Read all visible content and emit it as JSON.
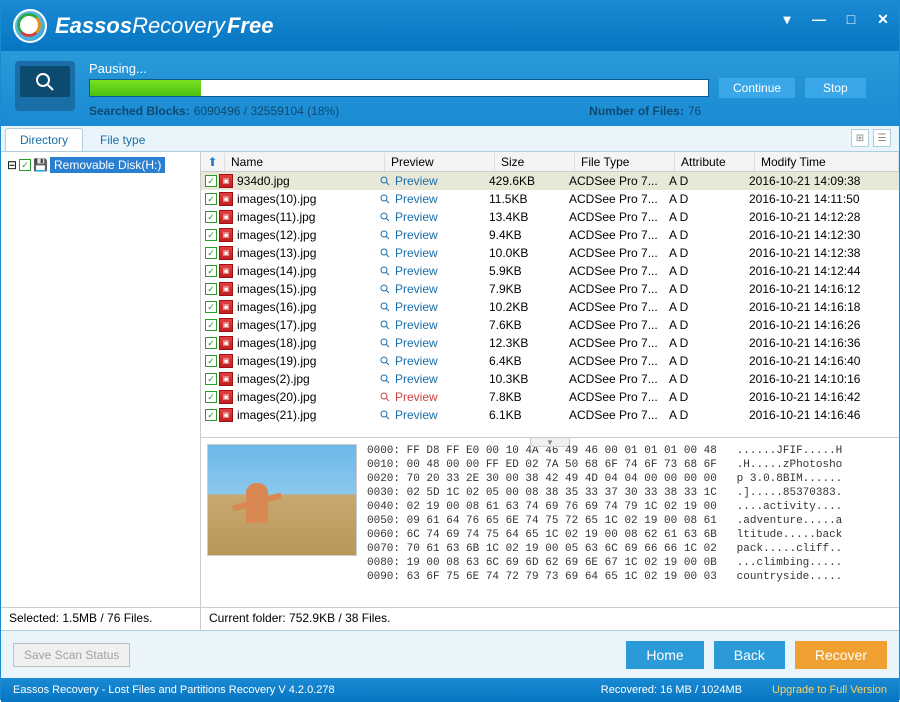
{
  "app": {
    "name1": "Eassos",
    "name2": "Recovery",
    "name3": "Free"
  },
  "progress": {
    "status": "Pausing...",
    "continue": "Continue",
    "stop": "Stop",
    "blocks_label": "Searched Blocks:",
    "blocks_value": "6090496 / 32559104 (18%)",
    "files_label": "Number of Files:",
    "files_value": "76"
  },
  "tabs": {
    "directory": "Directory",
    "filetype": "File type"
  },
  "tree": {
    "root": "Removable Disk(H:)"
  },
  "columns": {
    "name": "Name",
    "preview": "Preview",
    "size": "Size",
    "type": "File Type",
    "attr": "Attribute",
    "mod": "Modify Time"
  },
  "preview_label": "Preview",
  "files": [
    {
      "name": "934d0.jpg",
      "size": "429.6KB",
      "type": "ACDSee Pro 7...",
      "attr": "A D",
      "mod": "2016-10-21 14:09:38",
      "sel": true
    },
    {
      "name": "images(10).jpg",
      "size": "11.5KB",
      "type": "ACDSee Pro 7...",
      "attr": "A D",
      "mod": "2016-10-21 14:11:50"
    },
    {
      "name": "images(11).jpg",
      "size": "13.4KB",
      "type": "ACDSee Pro 7...",
      "attr": "A D",
      "mod": "2016-10-21 14:12:28"
    },
    {
      "name": "images(12).jpg",
      "size": "9.4KB",
      "type": "ACDSee Pro 7...",
      "attr": "A D",
      "mod": "2016-10-21 14:12:30"
    },
    {
      "name": "images(13).jpg",
      "size": "10.0KB",
      "type": "ACDSee Pro 7...",
      "attr": "A D",
      "mod": "2016-10-21 14:12:38"
    },
    {
      "name": "images(14).jpg",
      "size": "5.9KB",
      "type": "ACDSee Pro 7...",
      "attr": "A D",
      "mod": "2016-10-21 14:12:44"
    },
    {
      "name": "images(15).jpg",
      "size": "7.9KB",
      "type": "ACDSee Pro 7...",
      "attr": "A D",
      "mod": "2016-10-21 14:16:12"
    },
    {
      "name": "images(16).jpg",
      "size": "10.2KB",
      "type": "ACDSee Pro 7...",
      "attr": "A D",
      "mod": "2016-10-21 14:16:18"
    },
    {
      "name": "images(17).jpg",
      "size": "7.6KB",
      "type": "ACDSee Pro 7...",
      "attr": "A D",
      "mod": "2016-10-21 14:16:26"
    },
    {
      "name": "images(18).jpg",
      "size": "12.3KB",
      "type": "ACDSee Pro 7...",
      "attr": "A D",
      "mod": "2016-10-21 14:16:36"
    },
    {
      "name": "images(19).jpg",
      "size": "6.4KB",
      "type": "ACDSee Pro 7...",
      "attr": "A D",
      "mod": "2016-10-21 14:16:40"
    },
    {
      "name": "images(2).jpg",
      "size": "10.3KB",
      "type": "ACDSee Pro 7...",
      "attr": "A D",
      "mod": "2016-10-21 14:10:16"
    },
    {
      "name": "images(20).jpg",
      "size": "7.8KB",
      "type": "ACDSee Pro 7...",
      "attr": "A D",
      "mod": "2016-10-21 14:16:42",
      "preview_red": true
    },
    {
      "name": "images(21).jpg",
      "size": "6.1KB",
      "type": "ACDSee Pro 7...",
      "attr": "A D",
      "mod": "2016-10-21 14:16:46"
    }
  ],
  "hex": "0000: FF D8 FF E0 00 10 4A 46 49 46 00 01 01 01 00 48   ......JFIF.....H\n0010: 00 48 00 00 FF ED 02 7A 50 68 6F 74 6F 73 68 6F   .H.....zPhotosho\n0020: 70 20 33 2E 30 00 38 42 49 4D 04 04 00 00 00 00   p 3.0.8BIM......\n0030: 02 5D 1C 02 05 00 08 38 35 33 37 30 33 38 33 1C   .].....85370383.\n0040: 02 19 00 08 61 63 74 69 76 69 74 79 1C 02 19 00   ....activity....\n0050: 09 61 64 76 65 6E 74 75 72 65 1C 02 19 00 08 61   .adventure.....a\n0060: 6C 74 69 74 75 64 65 1C 02 19 00 08 62 61 63 6B   ltitude.....back\n0070: 70 61 63 6B 1C 02 19 00 05 63 6C 69 66 66 1C 02   pack.....cliff..\n0080: 19 00 08 63 6C 69 6D 62 69 6E 67 1C 02 19 00 0B   ...climbing.....\n0090: 63 6F 75 6E 74 72 79 73 69 64 65 1C 02 19 00 03   countryside.....",
  "status": {
    "selected": "Selected: 1.5MB / 76 Files.",
    "current": "Current folder: 752.9KB / 38 Files."
  },
  "buttons": {
    "save_scan": "Save Scan Status",
    "home": "Home",
    "back": "Back",
    "recover": "Recover"
  },
  "footer": {
    "text": "Eassos Recovery - Lost Files and Partitions Recovery  V 4.2.0.278",
    "recovered": "Recovered: 16 MB / 1024MB",
    "upgrade": "Upgrade to Full Version"
  }
}
